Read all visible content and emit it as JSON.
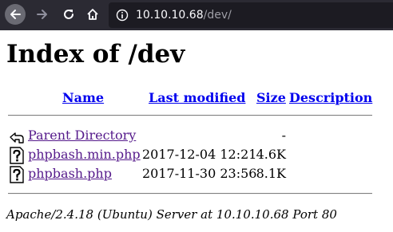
{
  "browser": {
    "url_host": "10.10.10.68",
    "url_path": "/dev/"
  },
  "page": {
    "title": "Index of /dev",
    "columns": {
      "name": "Name",
      "last_modified": "Last modified",
      "size": "Size",
      "description": "Description"
    },
    "entries": [
      {
        "name": "Parent Directory",
        "modified": "",
        "size": "-",
        "icon": "parent-directory-icon"
      },
      {
        "name": "phpbash.min.php",
        "modified": "2017-12-04 12:21",
        "size": "4.6K",
        "icon": "unknown-file-icon"
      },
      {
        "name": "phpbash.php",
        "modified": "2017-11-30 23:56",
        "size": "8.1K",
        "icon": "unknown-file-icon"
      }
    ],
    "address": "Apache/2.4.18 (Ubuntu) Server at 10.10.10.68 Port 80"
  },
  "colors": {
    "toolbar": "#2b2a33",
    "urlbar": "#1c1b22",
    "link": "#0000ee",
    "visited_link": "#551a8b"
  }
}
